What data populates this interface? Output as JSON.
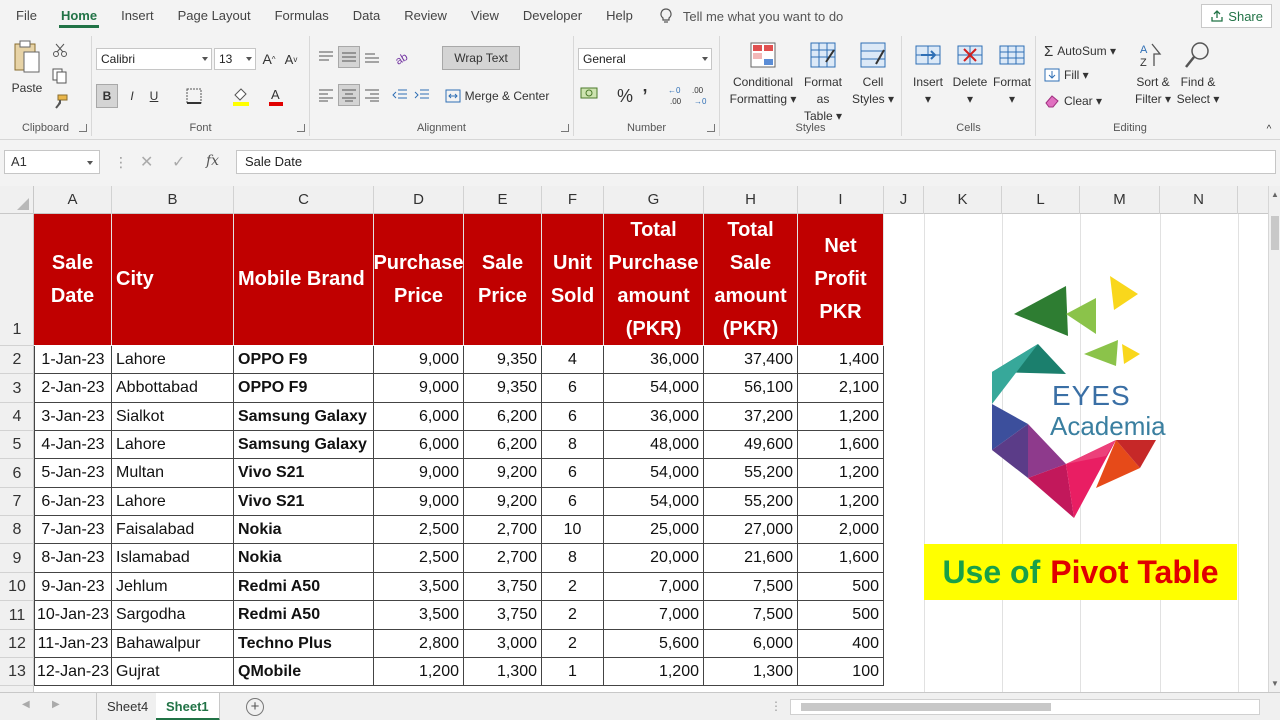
{
  "menu": {
    "tabs": [
      "File",
      "Home",
      "Insert",
      "Page Layout",
      "Formulas",
      "Data",
      "Review",
      "View",
      "Developer",
      "Help"
    ],
    "active_tab": "Home",
    "tell_me": "Tell me what you want to do",
    "share": "Share"
  },
  "ribbon": {
    "clipboard": {
      "paste": "Paste",
      "label": "Clipboard"
    },
    "font": {
      "name": "Calibri",
      "size": "13",
      "bold": "B",
      "italic": "I",
      "underline": "U",
      "label": "Font"
    },
    "alignment": {
      "wrap_text": "Wrap Text",
      "merge_center": "Merge & Center",
      "label": "Alignment"
    },
    "number": {
      "format": "General",
      "percent": "%",
      "comma": "’",
      "label": "Number"
    },
    "styles": {
      "conditional": [
        "Conditional",
        "Formatting"
      ],
      "format_table": [
        "Format as",
        "Table"
      ],
      "cell_styles": [
        "Cell",
        "Styles"
      ],
      "label": "Styles"
    },
    "cells": {
      "insert": "Insert",
      "delete": "Delete",
      "format": "Format",
      "label": "Cells"
    },
    "editing": {
      "autosum": "AutoSum",
      "fill": "Fill",
      "clear": "Clear",
      "sort": [
        "Sort &",
        "Filter"
      ],
      "find": [
        "Find &",
        "Select"
      ],
      "label": "Editing"
    }
  },
  "formula_bar": {
    "name_box": "A1",
    "fx": "fx",
    "content": "Sale Date"
  },
  "columns": [
    "A",
    "B",
    "C",
    "D",
    "E",
    "F",
    "G",
    "H",
    "I",
    "J",
    "K",
    "L",
    "M",
    "N"
  ],
  "rows": [
    "1",
    "2",
    "3",
    "4",
    "5",
    "6",
    "7",
    "8",
    "9",
    "10",
    "11",
    "12",
    "13"
  ],
  "table": {
    "headers": [
      "Sale Date",
      "City",
      "Mobile Brand",
      "Purchase Price",
      "Sale Price",
      "Unit Sold",
      "Total Purchase amount (PKR)",
      "Total Sale amount (PKR)",
      "Net Profit PKR"
    ],
    "data": [
      [
        "1-Jan-23",
        "Lahore",
        "OPPO F9",
        "9,000",
        "9,350",
        "4",
        "36,000",
        "37,400",
        "1,400"
      ],
      [
        "2-Jan-23",
        "Abbottabad",
        "OPPO F9",
        "9,000",
        "9,350",
        "6",
        "54,000",
        "56,100",
        "2,100"
      ],
      [
        "3-Jan-23",
        "Sialkot",
        "Samsung Galaxy",
        "6,000",
        "6,200",
        "6",
        "36,000",
        "37,200",
        "1,200"
      ],
      [
        "4-Jan-23",
        "Lahore",
        "Samsung Galaxy",
        "6,000",
        "6,200",
        "8",
        "48,000",
        "49,600",
        "1,600"
      ],
      [
        "5-Jan-23",
        "Multan",
        "Vivo S21",
        "9,000",
        "9,200",
        "6",
        "54,000",
        "55,200",
        "1,200"
      ],
      [
        "6-Jan-23",
        "Lahore",
        "Vivo S21",
        "9,000",
        "9,200",
        "6",
        "54,000",
        "55,200",
        "1,200"
      ],
      [
        "7-Jan-23",
        "Faisalabad",
        "Nokia",
        "2,500",
        "2,700",
        "10",
        "25,000",
        "27,000",
        "2,000"
      ],
      [
        "8-Jan-23",
        "Islamabad",
        "Nokia",
        "2,500",
        "2,700",
        "8",
        "20,000",
        "21,600",
        "1,600"
      ],
      [
        "9-Jan-23",
        "Jehlum",
        "Redmi A50",
        "3,500",
        "3,750",
        "2",
        "7,000",
        "7,500",
        "500"
      ],
      [
        "10-Jan-23",
        "Sargodha",
        "Redmi A50",
        "3,500",
        "3,750",
        "2",
        "7,000",
        "7,500",
        "500"
      ],
      [
        "11-Jan-23",
        "Bahawalpur",
        "Techno Plus",
        "2,800",
        "3,000",
        "2",
        "5,600",
        "6,000",
        "400"
      ],
      [
        "12-Jan-23",
        "Gujrat",
        "QMobile",
        "1,200",
        "1,300",
        "1",
        "1,200",
        "1,300",
        "100"
      ]
    ]
  },
  "logo": {
    "line1": "EYES",
    "line2": "Academia"
  },
  "banner": {
    "part1": "Use of",
    "part2": "Pivot Table"
  },
  "sheets": [
    "Sheet4",
    "Sheet1"
  ],
  "active_sheet": "Sheet1",
  "colors": {
    "header_red": "#c00000",
    "excel_green": "#217346",
    "banner_yellow": "#ffff00"
  }
}
